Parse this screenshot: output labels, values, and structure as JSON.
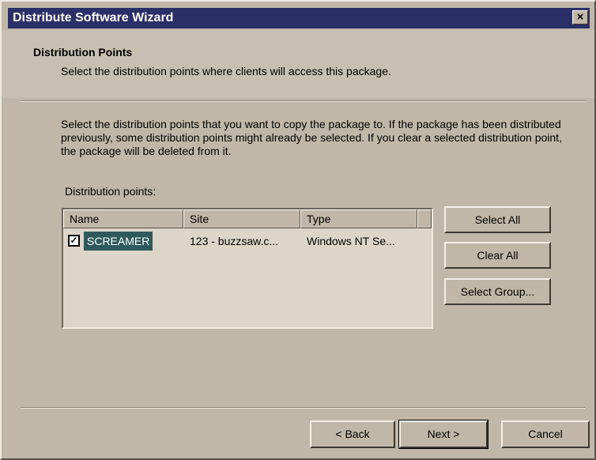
{
  "window": {
    "title": "Distribute Software Wizard",
    "close_glyph": "×"
  },
  "header": {
    "title": "Distribution Points",
    "subtitle": "Select the distribution points where clients will access this package."
  },
  "intro": {
    "text": "Select the distribution points that you want to copy the package to. If the package has been distributed previously, some distribution points might already be selected. If you clear a selected distribution point, the package will be deleted from it."
  },
  "distribution_points": {
    "label": "Distribution points:",
    "columns": [
      "Name",
      "Site",
      "Type"
    ],
    "rows": [
      {
        "checked": true,
        "check_glyph": "✓",
        "name": "SCREAMER",
        "site": "123 - buzzsaw.c...",
        "type": "Windows NT Se..."
      }
    ]
  },
  "side_buttons": {
    "select_all": "Select All",
    "clear_all": "Clear All",
    "select_group": "Select Group..."
  },
  "footer": {
    "back": "< Back",
    "next": "Next >",
    "cancel": "Cancel"
  },
  "colors": {
    "titlebar": "#2b2f68",
    "dialog": "#c1b7a8",
    "selection": "#2f5a5d"
  },
  "icons": [
    "close-icon",
    "checkbox-checked-icon"
  ]
}
